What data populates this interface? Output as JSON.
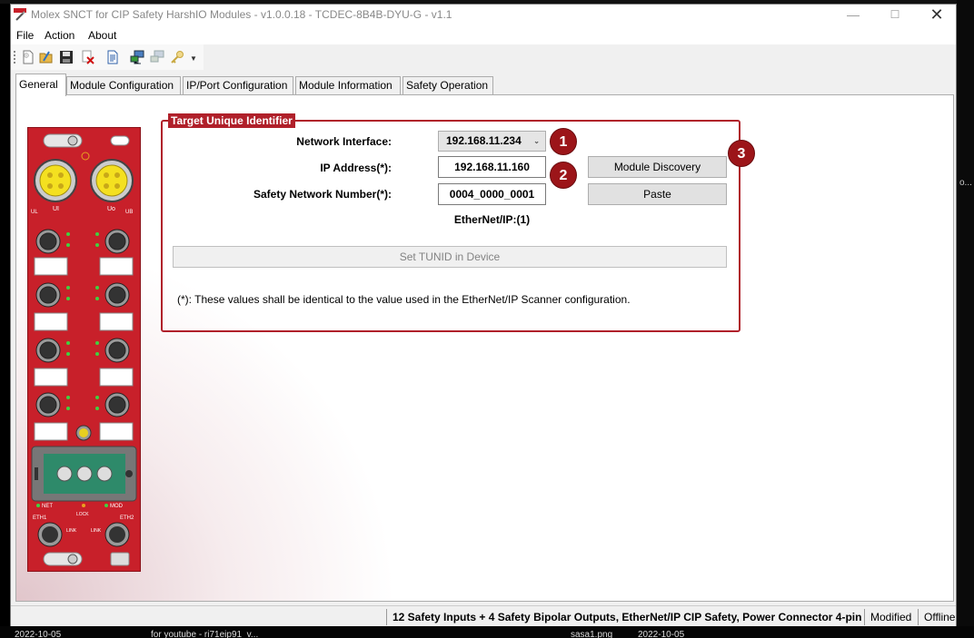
{
  "window": {
    "title": "Molex SNCT for CIP Safety HarshIO Modules - v1.0.0.18 - TCDEC-8B4B-DYU-G - v1.1"
  },
  "menu": {
    "file": "File",
    "action": "Action",
    "about": "About"
  },
  "tabs": [
    {
      "label": "General",
      "active": true
    },
    {
      "label": "Module Configuration"
    },
    {
      "label": "IP/Port Configuration"
    },
    {
      "label": "Module Information"
    },
    {
      "label": "Safety Operation"
    }
  ],
  "tunid": {
    "group_title": "Target Unique Identifier",
    "network_interface_label": "Network Interface:",
    "network_interface_value": "192.168.11.234",
    "ip_label": "IP Address(*):",
    "ip_value": "192.168.11.160",
    "snn_label": "Safety Network Number(*):",
    "snn_value": "0004_0000_0001",
    "ethernet_ip": "EtherNet/IP:(1)",
    "module_discovery": "Module Discovery",
    "paste": "Paste",
    "set_tunid": "Set TUNID in Device",
    "note": "(*): These values shall be identical to the value used in the EtherNet/IP Scanner configuration."
  },
  "badges": [
    "1",
    "2",
    "3"
  ],
  "status": {
    "description": "12 Safety Inputs + 4 Safety Bipolar Outputs, EtherNet/IP CIP Safety, Power Connector 4-pin",
    "modified": "Modified",
    "connection": "Offline"
  },
  "module_labels": {
    "ui": "UI",
    "uo": "Uo",
    "ul": "UL",
    "ub": "UB",
    "net": "NET",
    "mod": "MOD",
    "lock": "LOCK",
    "eth1": "ETH1",
    "eth2": "ETH2",
    "link1": "LINK",
    "link2": "LINK"
  },
  "desktop": {
    "bottom_1": "2022-10-05",
    "bottom_2": "for youtube - ri71eip91_v...",
    "bottom_3": "sasa1.png",
    "bottom_4": "2022-10-05",
    "right": "o..."
  },
  "colors": {
    "accent": "#b0202a",
    "badge": "#9c1519",
    "module_body": "#c8202a"
  }
}
